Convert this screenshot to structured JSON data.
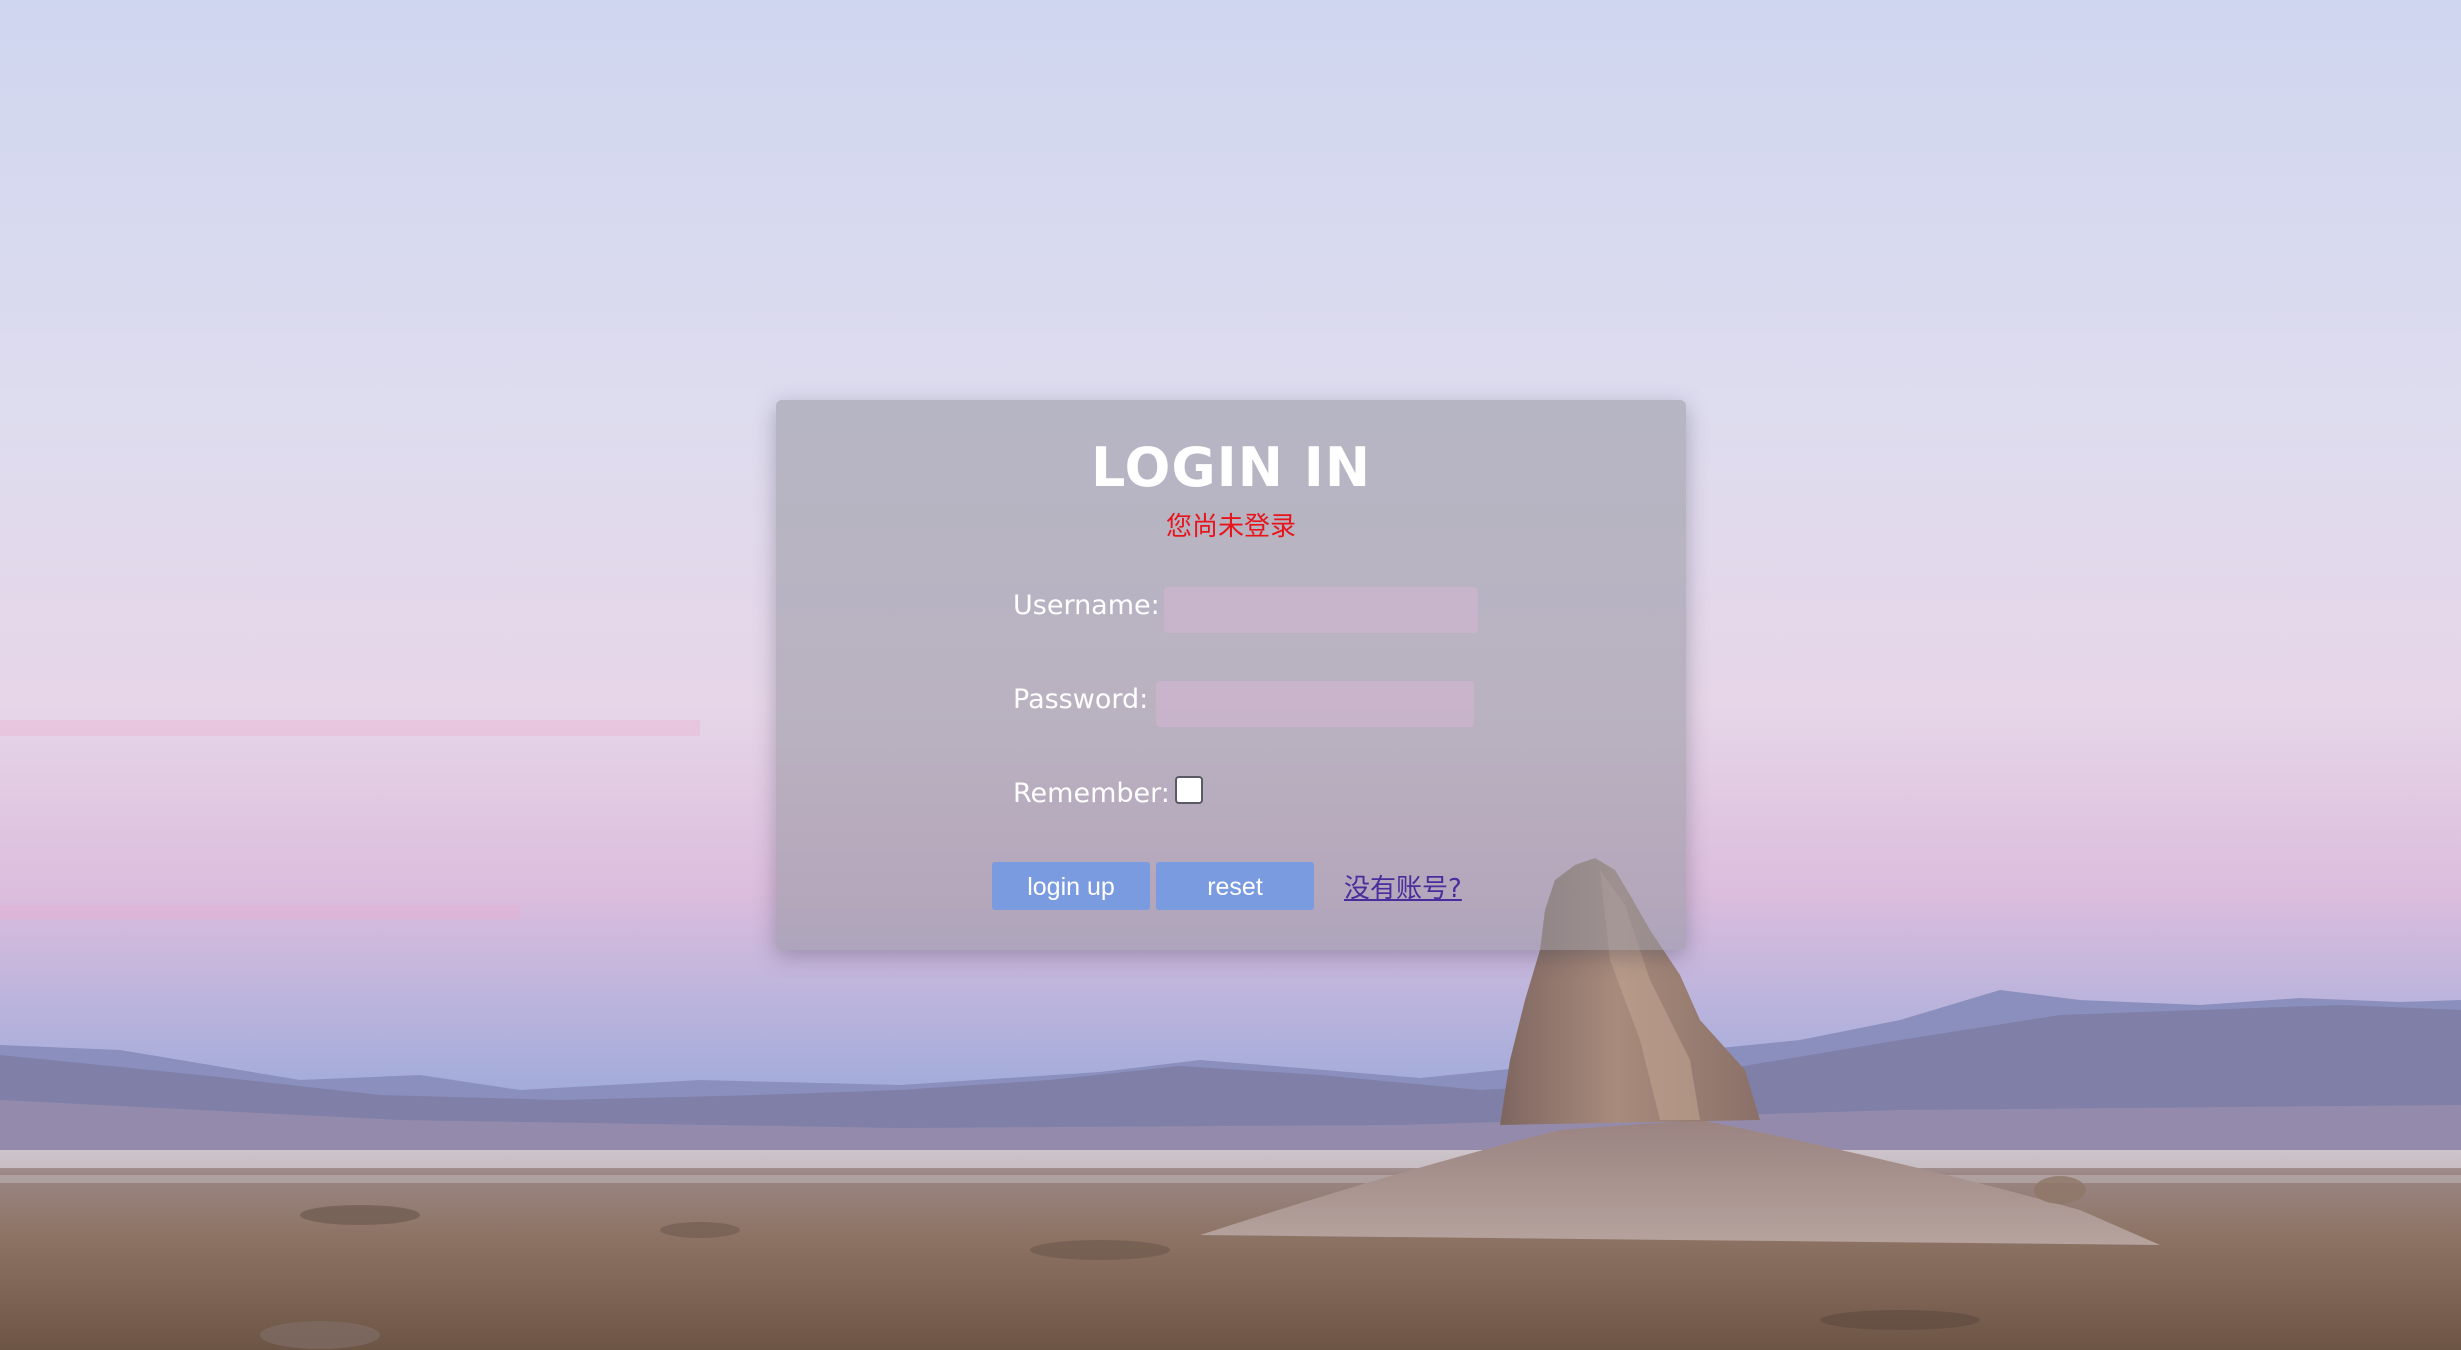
{
  "login": {
    "title": "LOGIN IN",
    "status_message": "您尚未登录",
    "username_label": "Username:",
    "username_value": "",
    "password_label": "Password:",
    "password_value": "",
    "remember_label": "Remember:",
    "remember_checked": false,
    "login_button": "login up",
    "reset_button": "reset",
    "register_link": "没有账号?"
  },
  "colors": {
    "button_bg": "#7b9be0",
    "status_text": "#e8141c",
    "link_text": "#4b2c9c",
    "input_bg": "#cdb4cd"
  }
}
